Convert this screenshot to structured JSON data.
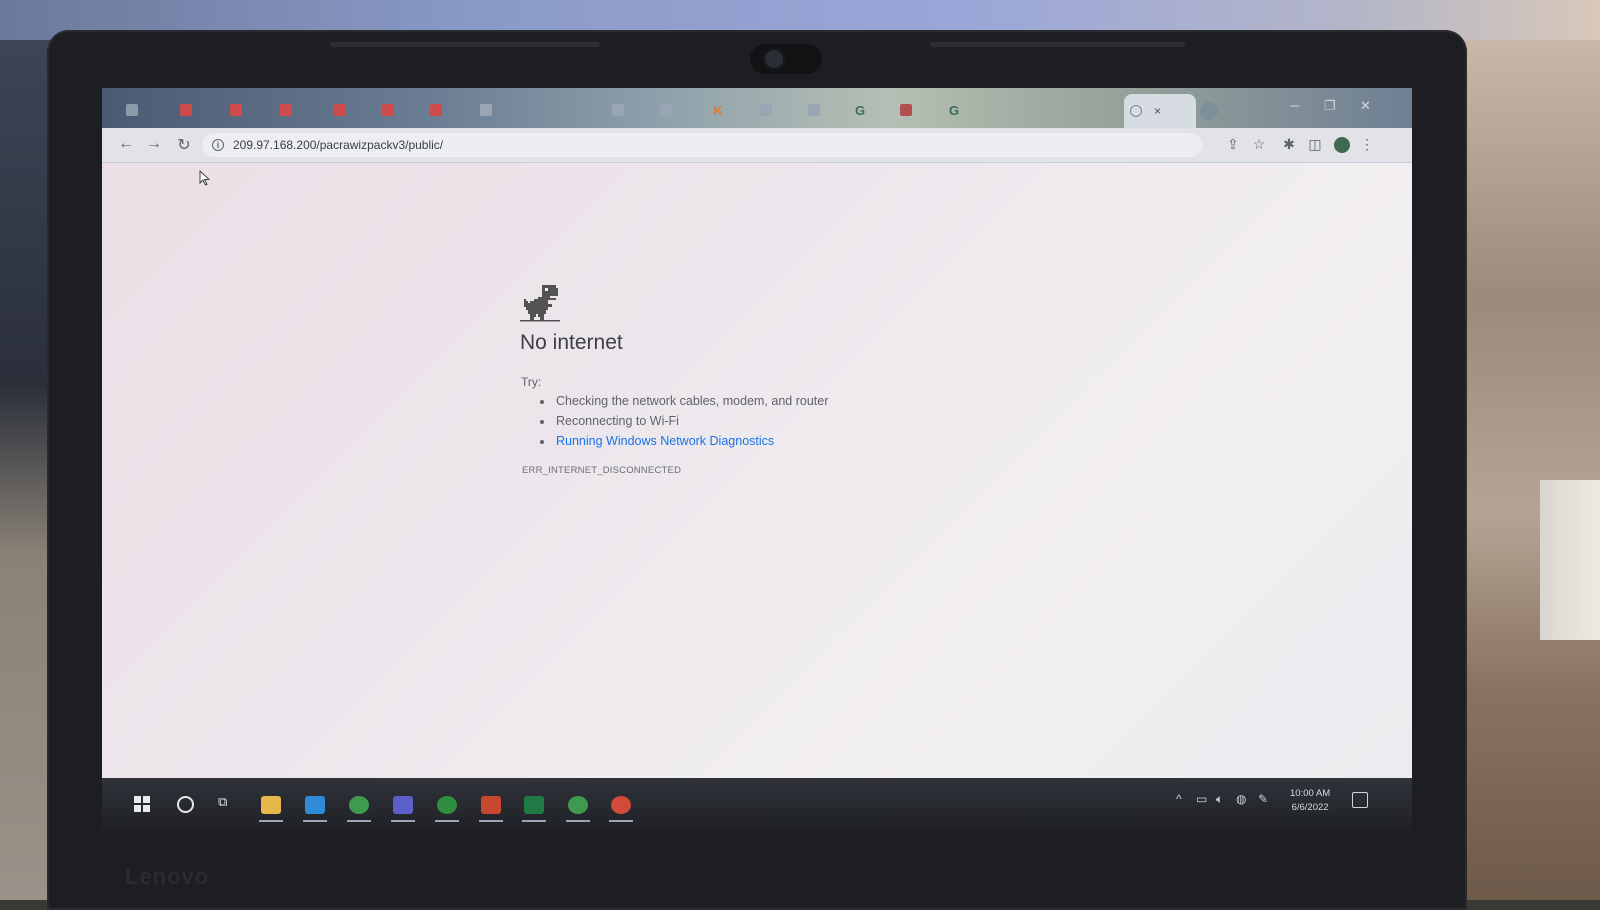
{
  "browser": {
    "url": "209.97.168.200/pacrawizpackv3/public/",
    "tabs": [
      {
        "icon": "meet-icon",
        "color": "#8c9aaa"
      },
      {
        "icon": "doc-icon",
        "color": "#cf4a4a"
      },
      {
        "icon": "doc-icon",
        "color": "#cf4a4a"
      },
      {
        "icon": "doc-icon",
        "color": "#cf4a4a"
      },
      {
        "icon": "doc-icon",
        "color": "#cf4a4a"
      },
      {
        "icon": "doc-icon",
        "color": "#cf4a4a"
      },
      {
        "icon": "doc-icon",
        "color": "#cf4a4a"
      },
      {
        "icon": "meet-icon",
        "color": "#9aa5b3"
      },
      {
        "icon": "video-icon",
        "color": "#9aa5b3"
      },
      {
        "icon": "video-icon",
        "color": "#9aa5b3"
      },
      {
        "icon": "k-icon",
        "label": "K",
        "color": "#e07a2e"
      },
      {
        "icon": "meet-icon",
        "color": "#9aa5b3"
      },
      {
        "icon": "video-icon",
        "color": "#9aa5b3"
      },
      {
        "icon": "grammarly-icon",
        "label": "G",
        "color": "#3a6b54"
      },
      {
        "icon": "image-icon",
        "color": "#b44f4f"
      },
      {
        "icon": "grammarly-icon",
        "label": "G",
        "color": "#3a6b54"
      }
    ],
    "active_tab": {
      "close_label": "×"
    }
  },
  "error_page": {
    "title": "No internet",
    "try_label": "Try:",
    "suggestions": [
      "Checking the network cables, modem, and router",
      "Reconnecting to Wi-Fi"
    ],
    "diagnostics_link": "Running Windows Network Diagnostics",
    "error_code": "ERR_INTERNET_DISCONNECTED"
  },
  "taskbar": {
    "apps": [
      {
        "name": "file-explorer",
        "color": "#e6b84a"
      },
      {
        "name": "mail",
        "color": "#2f8ad8"
      },
      {
        "name": "chrome",
        "color": "#3f9a4f"
      },
      {
        "name": "teams",
        "color": "#5b5fc7"
      },
      {
        "name": "green-circle",
        "color": "#2f8f3f"
      },
      {
        "name": "powerpoint",
        "color": "#c8472f"
      },
      {
        "name": "excel",
        "color": "#1f7a46"
      },
      {
        "name": "chrome-2",
        "color": "#3f9a4f"
      },
      {
        "name": "chrome-3",
        "color": "#d14a3c"
      }
    ],
    "clock_time": "10:00 AM",
    "clock_date": "6/6/2022"
  },
  "laptop": {
    "brand": "Lenovo"
  }
}
